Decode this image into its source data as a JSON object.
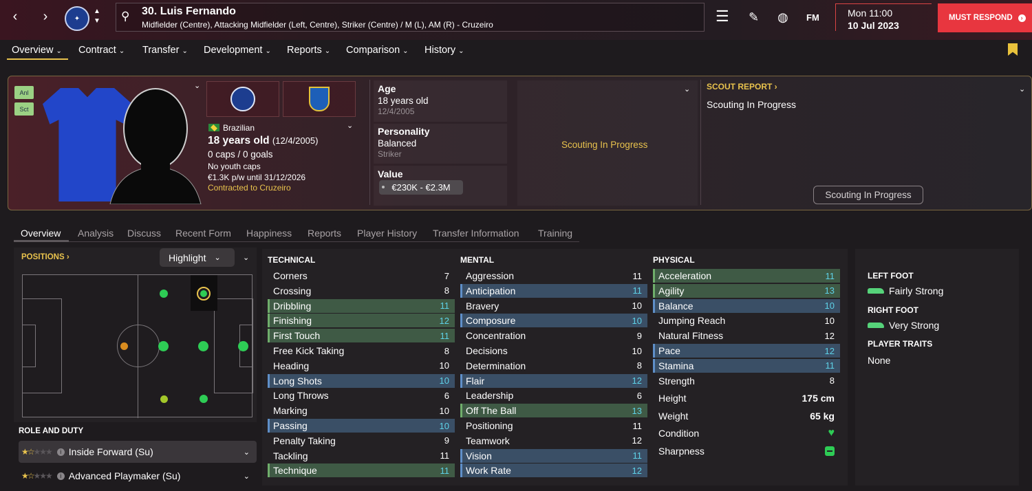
{
  "header": {
    "player_name": "30. Luis Fernando",
    "positions": "Midfielder (Centre), Attacking Midfielder (Left, Centre), Striker (Centre) / M (L), AM (R) - Cruzeiro",
    "time": "Mon 11:00",
    "date": "10 Jul 2023",
    "must_respond": "MUST RESPOND",
    "fm_label": "FM"
  },
  "menu": [
    "Overview",
    "Contract",
    "Transfer",
    "Development",
    "Reports",
    "Comparison",
    "History"
  ],
  "tags": {
    "anl": "Anl",
    "sct": "Sct"
  },
  "profile": {
    "nationality": "Brazilian",
    "age_main": "18 years old",
    "age_dob": "(12/4/2005)",
    "caps": "0 caps / 0 goals",
    "youth_caps": "No youth caps",
    "wage": "€1.3K p/w until 31/12/2026",
    "contract": "Contracted to Cruzeiro"
  },
  "info": {
    "age_label": "Age",
    "age_value": "18 years old",
    "age_dob": "12/4/2005",
    "personality_label": "Personality",
    "personality_value": "Balanced",
    "personality_sub": "Striker",
    "value_label": "Value",
    "value_range": "€230K - €2.3M"
  },
  "scout": {
    "middle_text": "Scouting In Progress",
    "title": "SCOUT REPORT ›",
    "text": "Scouting In Progress",
    "button": "Scouting In Progress"
  },
  "tabs": [
    "Overview",
    "Analysis",
    "Discuss",
    "Recent Form",
    "Happiness",
    "Reports",
    "Player History",
    "Transfer Information",
    "Training"
  ],
  "positions": {
    "title": "POSITIONS ›",
    "filter": "Highlight"
  },
  "role": {
    "title": "ROLE AND DUTY",
    "roles": [
      {
        "name": "Inside Forward (Su)",
        "stars": 1.5
      },
      {
        "name": "Advanced Playmaker (Su)",
        "stars": 1.5
      }
    ]
  },
  "technical": {
    "title": "TECHNICAL",
    "rows": [
      {
        "name": "Corners",
        "value": "7",
        "hl": ""
      },
      {
        "name": "Crossing",
        "value": "8",
        "hl": ""
      },
      {
        "name": "Dribbling",
        "value": "11",
        "hl": "g"
      },
      {
        "name": "Finishing",
        "value": "12",
        "hl": "g"
      },
      {
        "name": "First Touch",
        "value": "11",
        "hl": "g"
      },
      {
        "name": "Free Kick Taking",
        "value": "8",
        "hl": ""
      },
      {
        "name": "Heading",
        "value": "10",
        "hl": ""
      },
      {
        "name": "Long Shots",
        "value": "10",
        "hl": "b"
      },
      {
        "name": "Long Throws",
        "value": "6",
        "hl": ""
      },
      {
        "name": "Marking",
        "value": "10",
        "hl": ""
      },
      {
        "name": "Passing",
        "value": "10",
        "hl": "b"
      },
      {
        "name": "Penalty Taking",
        "value": "9",
        "hl": ""
      },
      {
        "name": "Tackling",
        "value": "11",
        "hl": ""
      },
      {
        "name": "Technique",
        "value": "11",
        "hl": "g"
      }
    ]
  },
  "mental": {
    "title": "MENTAL",
    "rows": [
      {
        "name": "Aggression",
        "value": "11",
        "hl": ""
      },
      {
        "name": "Anticipation",
        "value": "11",
        "hl": "b"
      },
      {
        "name": "Bravery",
        "value": "10",
        "hl": ""
      },
      {
        "name": "Composure",
        "value": "10",
        "hl": "b"
      },
      {
        "name": "Concentration",
        "value": "9",
        "hl": ""
      },
      {
        "name": "Decisions",
        "value": "10",
        "hl": ""
      },
      {
        "name": "Determination",
        "value": "8",
        "hl": ""
      },
      {
        "name": "Flair",
        "value": "12",
        "hl": "b"
      },
      {
        "name": "Leadership",
        "value": "6",
        "hl": ""
      },
      {
        "name": "Off The Ball",
        "value": "13",
        "hl": "g"
      },
      {
        "name": "Positioning",
        "value": "11",
        "hl": ""
      },
      {
        "name": "Teamwork",
        "value": "12",
        "hl": ""
      },
      {
        "name": "Vision",
        "value": "11",
        "hl": "b"
      },
      {
        "name": "Work Rate",
        "value": "12",
        "hl": "b"
      }
    ]
  },
  "physical": {
    "title": "PHYSICAL",
    "rows": [
      {
        "name": "Acceleration",
        "value": "11",
        "hl": "g"
      },
      {
        "name": "Agility",
        "value": "13",
        "hl": "g"
      },
      {
        "name": "Balance",
        "value": "10",
        "hl": "b"
      },
      {
        "name": "Jumping Reach",
        "value": "10",
        "hl": ""
      },
      {
        "name": "Natural Fitness",
        "value": "12",
        "hl": ""
      },
      {
        "name": "Pace",
        "value": "12",
        "hl": "b"
      },
      {
        "name": "Stamina",
        "value": "11",
        "hl": "b"
      },
      {
        "name": "Strength",
        "value": "8",
        "hl": ""
      }
    ],
    "height_label": "Height",
    "height_value": "175 cm",
    "weight_label": "Weight",
    "weight_value": "65 kg",
    "condition_label": "Condition",
    "sharpness_label": "Sharpness"
  },
  "feet": {
    "left_title": "LEFT FOOT",
    "left_value": "Fairly Strong",
    "right_title": "RIGHT FOOT",
    "right_value": "Very Strong",
    "traits_title": "PLAYER TRAITS",
    "traits_value": "None"
  },
  "colors": {
    "accent": "#e9c34d",
    "must_respond": "#e8363f",
    "highlight_green": "#3f5a45",
    "highlight_blue": "#3a4f66",
    "attr_cyan": "#5ed2e8",
    "pitch_dot": "#2ecc55"
  }
}
